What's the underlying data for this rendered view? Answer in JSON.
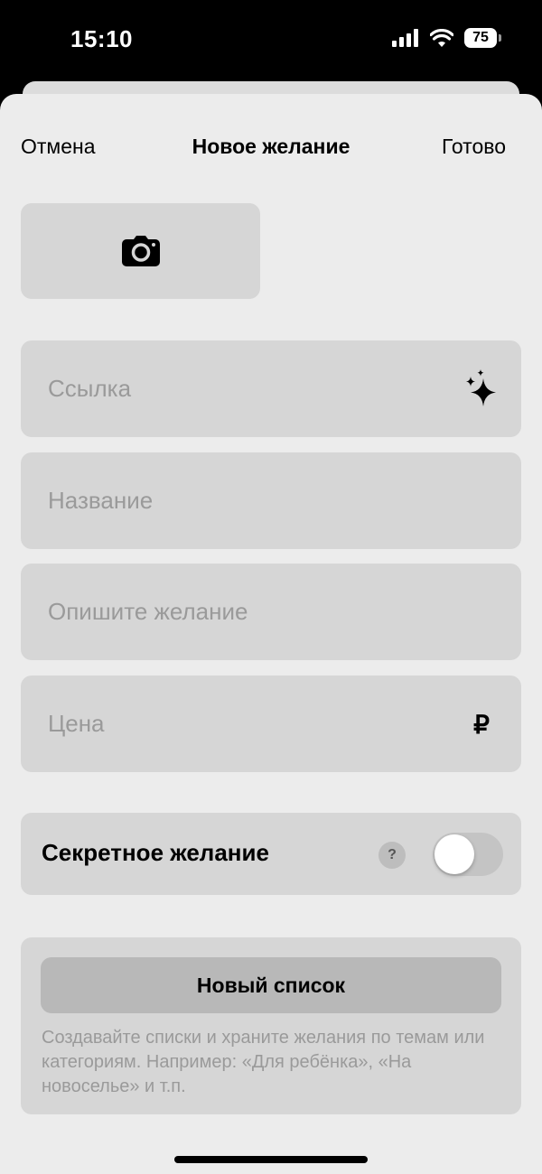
{
  "status_bar": {
    "time": "15:10",
    "battery": "75",
    "icons": [
      "signal-icon",
      "wifi-icon",
      "battery-icon"
    ]
  },
  "nav": {
    "cancel": "Отмена",
    "title": "Новое желание",
    "done": "Готово"
  },
  "photo": {
    "icon": "camera-icon"
  },
  "fields": {
    "link_placeholder": "Ссылка",
    "link_icon": "sparkles-icon",
    "name_placeholder": "Название",
    "description_placeholder": "Опишите желание",
    "price_placeholder": "Цена",
    "currency": "₽"
  },
  "secret": {
    "label": "Секретное желание",
    "help": "?",
    "enabled": false
  },
  "lists": {
    "button": "Новый список",
    "hint": "Создавайте списки и храните желания по темам или категориям. Например: «Для ребёнка», «На новоселье» и т.п."
  },
  "colors": {
    "sheet_bg": "#ececec",
    "field_bg": "#d6d6d6",
    "placeholder": "#9a9a9a",
    "button_bg": "#b8b8b8"
  }
}
